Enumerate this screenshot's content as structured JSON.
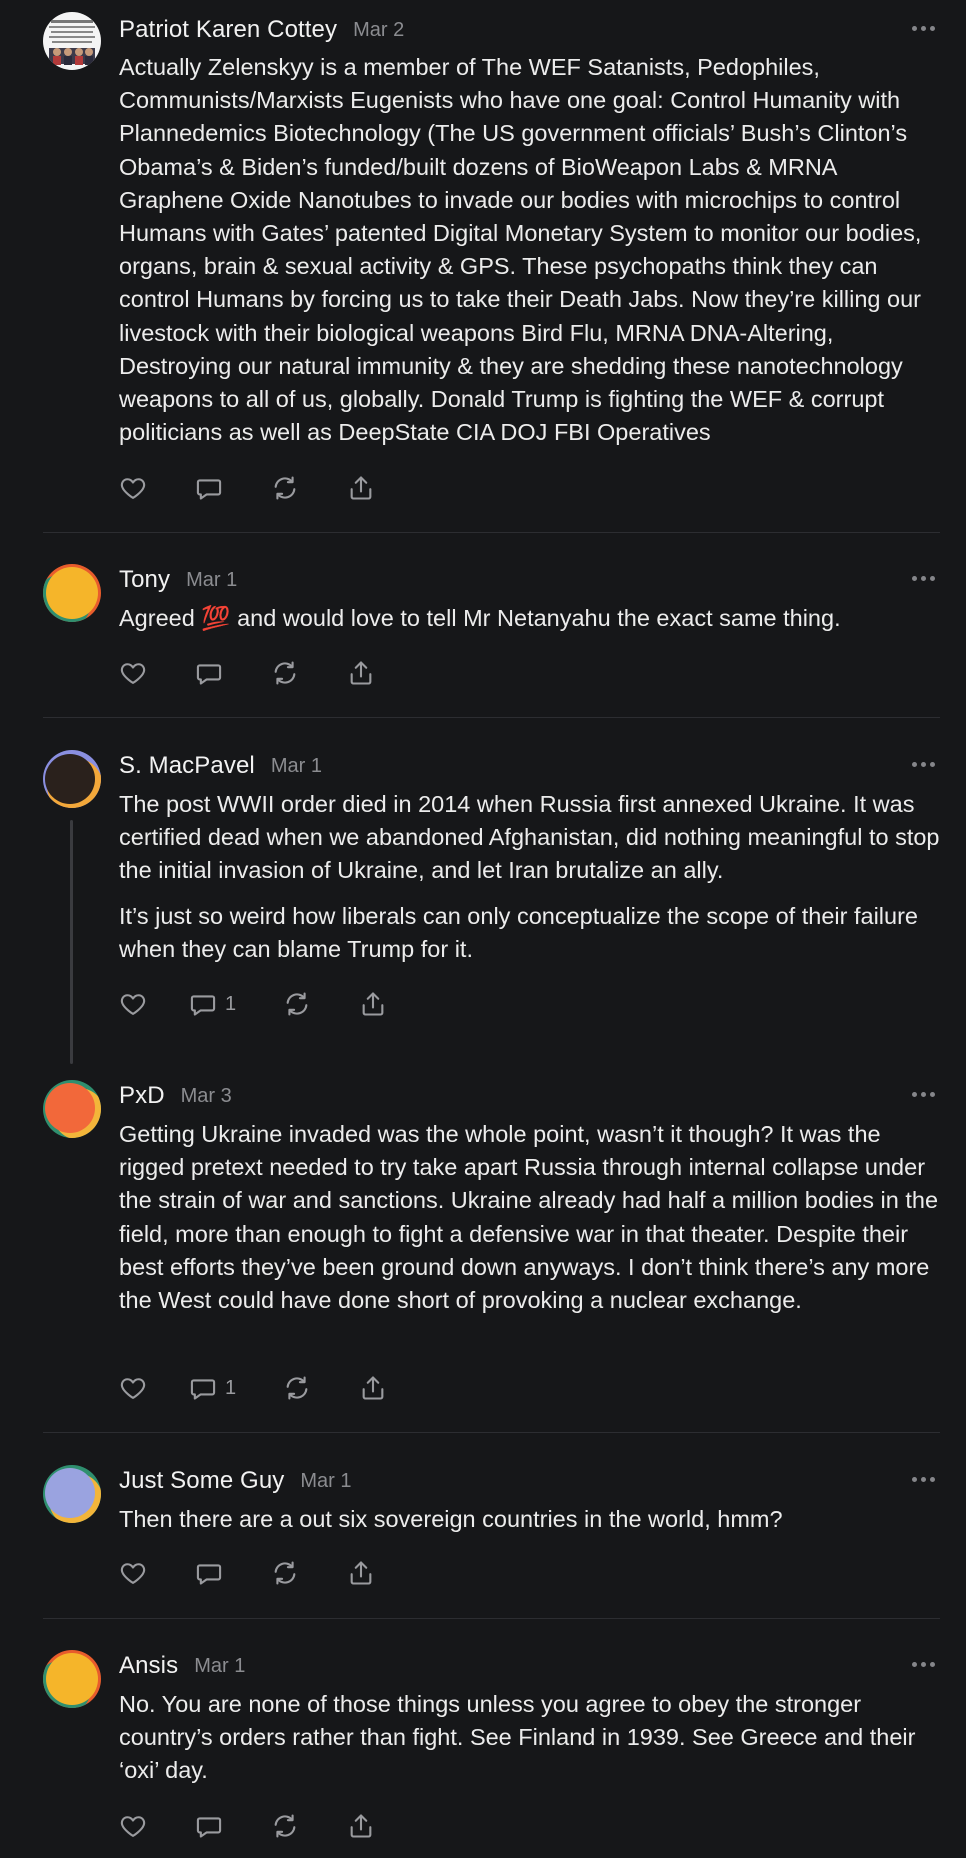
{
  "comments": [
    {
      "author": "Patriot Karen Cottey",
      "date": "Mar 2",
      "avatar": {
        "kind": "photo-thumbnail",
        "colors": [
          "#ffffff",
          "#2a2a3a",
          "#b23a3a"
        ]
      },
      "paragraphs": [
        "Actually Zelenskyy is a member of The WEF Satanists, Pedophiles, Communists/Marxists Eugenists who have one goal: Control Humanity with Plannedemics Biotechnology (The US government officials’ Bush’s Clinton’s Obama’s & Biden’s funded/built dozens of BioWeapon Labs & MRNA Graphene Oxide Nanotubes to invade our bodies with microchips to control Humans with Gates’ patented Digital Monetary System to monitor our bodies, organs, brain & sexual activity & GPS. These psychopaths think they can control Humans by forcing us to take their Death Jabs. Now they’re killing our livestock with their biological weapons Bird Flu, MRNA DNA-Altering, Destroying our natural immunity & they are shedding these nanotechnology weapons to all of us, globally. Donald Trump is fighting the WEF & corrupt politicians as well as DeepState CIA DOJ FBI Operatives"
      ],
      "reply_count": ""
    },
    {
      "author": "Tony",
      "date": "Mar 1",
      "avatar": {
        "kind": "gradient",
        "colors": [
          "#f5b52a",
          "#e85c2c",
          "#2f8f6f"
        ]
      },
      "paragraphs": [
        "Agreed 💯 and would love to tell Mr Netanyahu the exact same thing."
      ],
      "reply_count": ""
    },
    {
      "author": "S. MacPavel",
      "date": "Mar 1",
      "avatar": {
        "kind": "gradient",
        "colors": [
          "#2a211c",
          "#f3a83a",
          "#8a8fe0"
        ]
      },
      "paragraphs": [
        "The post WWII order died in 2014 when Russia first annexed Ukraine. It was certified dead when we abandoned Afghanistan, did nothing meaningful to stop the initial invasion of Ukraine, and let Iran brutalize an ally.",
        "It’s just so weird how liberals can only conceptualize the scope of their failure when they can blame Trump for it."
      ],
      "reply_count": "1"
    },
    {
      "author": "PxD",
      "date": "Mar 3",
      "avatar": {
        "kind": "gradient",
        "colors": [
          "#f2683a",
          "#f3b53a",
          "#2f8f6f"
        ]
      },
      "paragraphs": [
        "Getting Ukraine invaded was the whole point, wasn’t it though? It was the rigged pretext needed to try take apart Russia through internal collapse under the strain of war and sanctions. Ukraine already had half a million bodies in the field, more than enough to fight a defensive war in that theater. Despite their best efforts they’ve been ground down anyways. I don’t think there’s any more the West could have done short of provoking a nuclear exchange."
      ],
      "reply_count": "1"
    },
    {
      "author": "Just Some Guy",
      "date": "Mar 1",
      "avatar": {
        "kind": "gradient",
        "colors": [
          "#9aa3e0",
          "#f3b53a",
          "#2f8f6f"
        ]
      },
      "paragraphs": [
        "Then there are a out six sovereign countries in the world, hmm?"
      ],
      "reply_count": ""
    },
    {
      "author": "Ansis",
      "date": "Mar 1",
      "avatar": {
        "kind": "gradient",
        "colors": [
          "#f5b52a",
          "#e85c2c",
          "#2f8f6f"
        ]
      },
      "paragraphs": [
        "No. You are none of those things unless you agree to obey the stronger country’s orders rather than fight. See Finland in 1939. See Greece and their ‘oxi’ day."
      ],
      "reply_count": ""
    }
  ],
  "icons": {
    "like": "heart-icon",
    "reply": "comment-bubble-icon",
    "restack": "restack-arrows-icon",
    "share": "share-upload-icon",
    "more": "more-dots-icon"
  },
  "colors": {
    "background": "#161719",
    "text": "#ececec",
    "muted": "#8b8c90",
    "divider": "#2c2d31"
  }
}
